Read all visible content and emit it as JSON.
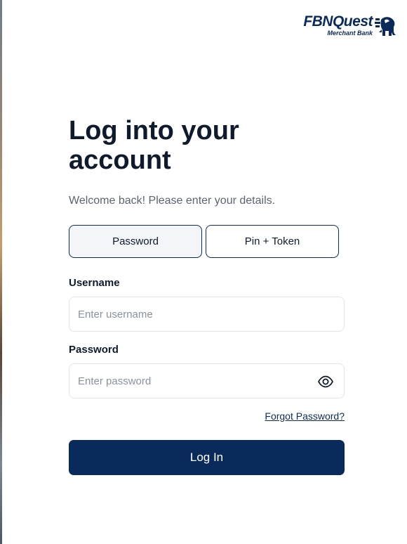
{
  "brand": {
    "name": "FBNQuest",
    "subname": "Merchant Bank",
    "icon": "elephant-emblem-icon",
    "color": "#0b2a5c"
  },
  "heading": {
    "title": "Log into your account",
    "subtitle": "Welcome back! Please enter your details."
  },
  "tabs": [
    {
      "label": "Password",
      "active": true
    },
    {
      "label": "Pin + Token",
      "active": false
    }
  ],
  "form": {
    "username": {
      "label": "Username",
      "placeholder": "Enter username",
      "value": ""
    },
    "password": {
      "label": "Password",
      "placeholder": "Enter password",
      "value": "",
      "toggle_icon": "eye-icon"
    },
    "forgot_label": "Forgot Password?",
    "submit_label": "Log In"
  },
  "colors": {
    "primary": "#0b2a5c",
    "text": "#0f1b2d",
    "muted": "#5b6472",
    "border": "#e1e4ea",
    "tab_active_bg": "#f3f5f9"
  }
}
